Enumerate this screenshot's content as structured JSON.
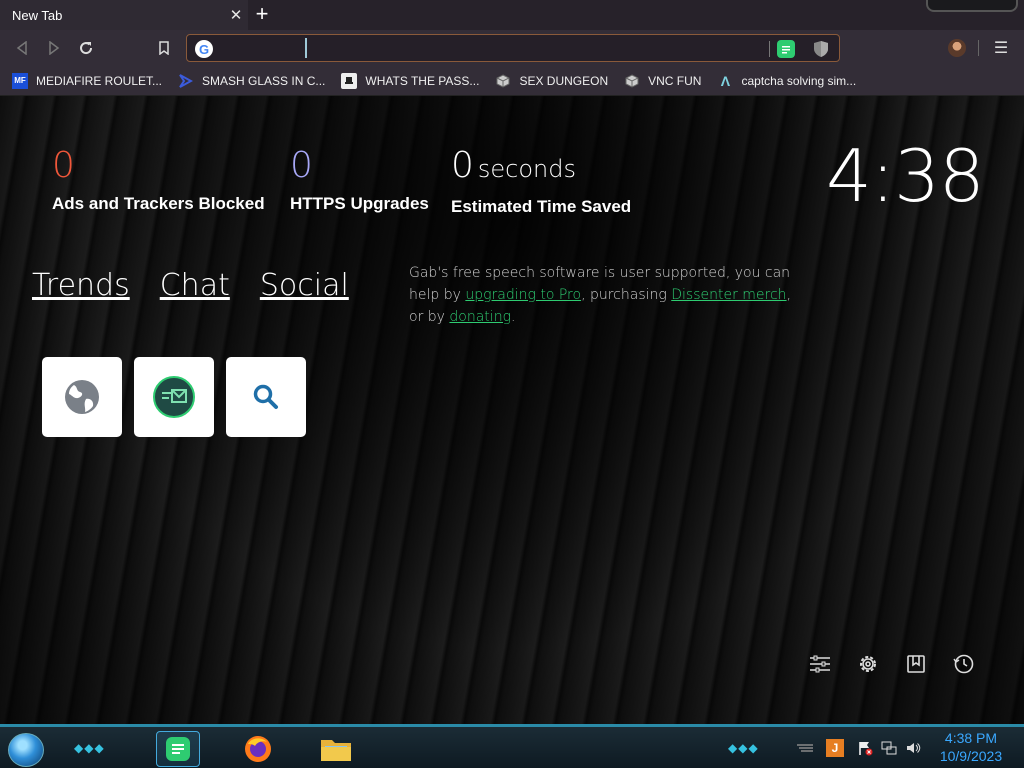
{
  "browser": {
    "tab": {
      "title": "New Tab",
      "close": "✕"
    },
    "new_tab": "+",
    "address": {
      "value": "",
      "placeholder": ""
    },
    "bookmarks": [
      {
        "label": "MEDIAFIRE ROULET...",
        "icon": "mediafire-icon",
        "color": "#1a4fd8"
      },
      {
        "label": "SMASH GLASS IN C...",
        "icon": "chevron-logo-icon",
        "color": "#3b5bdb"
      },
      {
        "label": "WHATS THE PASS...",
        "icon": "hat-icon",
        "color": "#333333"
      },
      {
        "label": "SEX DUNGEON",
        "icon": "cube-icon",
        "color": "#bbbbbb"
      },
      {
        "label": "VNC FUN",
        "icon": "cube-icon",
        "color": "#bbbbbb"
      },
      {
        "label": "captcha solving sim...",
        "icon": "lambda-icon",
        "color": "#7fd3e0"
      }
    ]
  },
  "stats": [
    {
      "value": "0",
      "unit": "",
      "label": "Ads and Trackers Blocked",
      "color": "#f0573a"
    },
    {
      "value": "0",
      "unit": "",
      "label": "HTTPS Upgrades",
      "color": "#a8a8f8"
    },
    {
      "value": "0",
      "unit": "seconds",
      "label": "Estimated Time Saved",
      "color": "#ffffff"
    }
  ],
  "clock": "4:38",
  "nav_links": [
    "Trends",
    "Chat",
    "Social"
  ],
  "gab_note": {
    "text1": "Gab's free speech software is user supported, you can help by ",
    "link1": "upgrading to Pro",
    "text2": ", purchasing ",
    "link2": "Dissenter merch",
    "text3": ", or by ",
    "link3": "donating",
    "text4": "."
  },
  "tiles": [
    {
      "name": "globe-tile",
      "icon": "globe-icon"
    },
    {
      "name": "chat-tile",
      "icon": "message-icon"
    },
    {
      "name": "search-tile",
      "icon": "search-icon"
    }
  ],
  "page_tools": [
    "sliders-icon",
    "gear-icon",
    "bookmark-icon",
    "history-icon"
  ],
  "taskbar": {
    "time": "4:38 PM",
    "date": "10/9/2023"
  }
}
